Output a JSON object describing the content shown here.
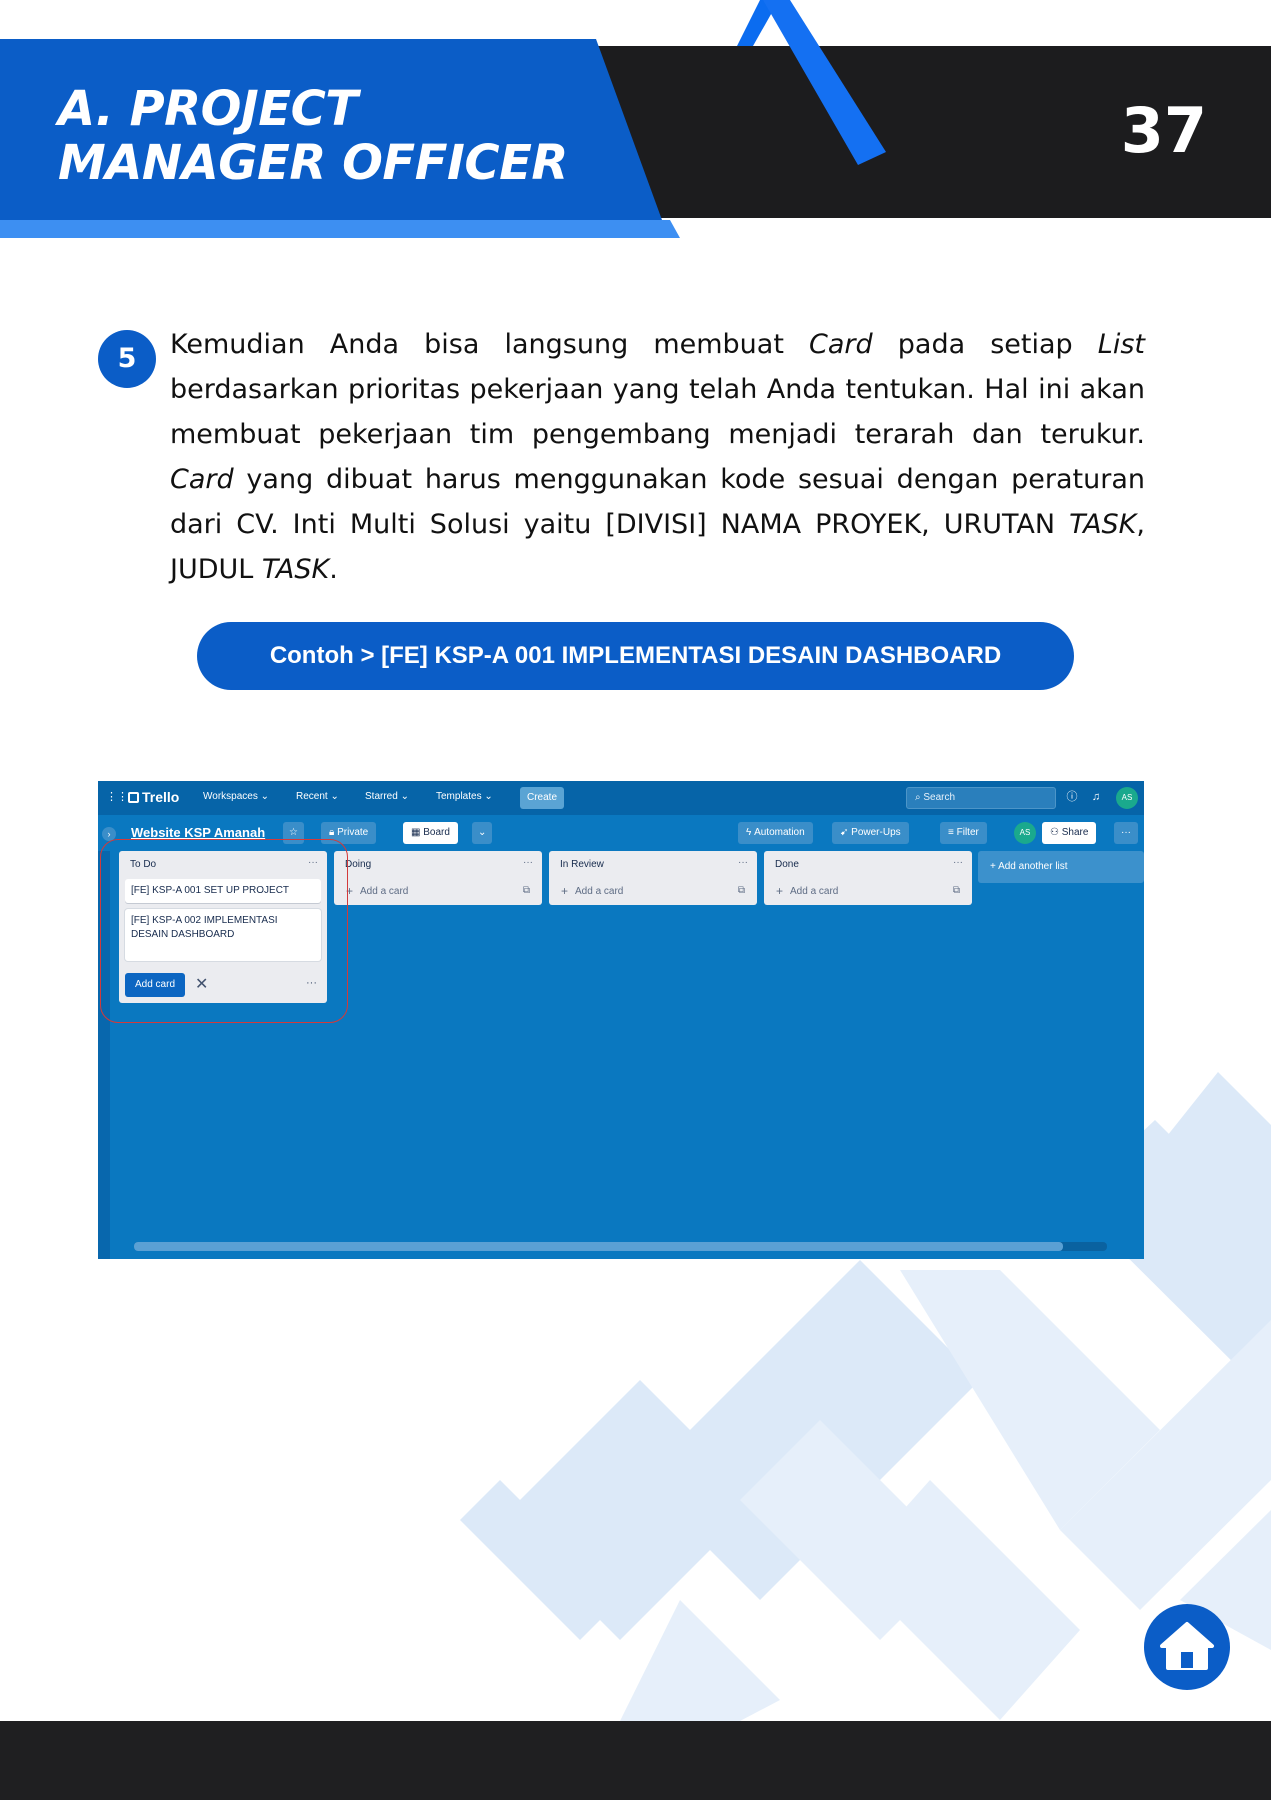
{
  "header": {
    "title_line1": "A. PROJECT",
    "title_line2": "MANAGER OFFICER",
    "page_number": "37"
  },
  "step": {
    "number": "5",
    "text_html": "Kemudian Anda bisa langsung membuat <em>Card</em> pada setiap <em>List</em> berdasarkan prioritas pekerjaan yang telah Anda tentukan. Hal ini akan membuat pekerjaan tim pengembang menjadi terarah dan terukur. <em>Card</em> yang dibuat harus menggunakan kode sesuai dengan peraturan dari CV. Inti Multi Solusi yaitu [DIVISI] NAMA PROYEK, URUTAN <em>TASK</em>, JUDUL <em>TASK</em>."
  },
  "example": {
    "label": "Contoh >  [FE] KSP-A 001 IMPLEMENTASI DESAIN DASHBOARD"
  },
  "trello": {
    "logo": "Trello",
    "menu": [
      "Workspaces ⌄",
      "Recent ⌄",
      "Starred ⌄",
      "Templates ⌄"
    ],
    "create": "Create",
    "search_placeholder": "Search",
    "avatar": "AS",
    "board_title": "Website KSP Amanah",
    "private": "Private",
    "board_view": "Board",
    "automation": "Automation",
    "power_ups": "Power-Ups",
    "filter": "Filter",
    "share": "Share",
    "add_another_list": "+ Add another list",
    "add_card_text": "Add a card",
    "add_card_button": "Add card",
    "lists": [
      {
        "title": "To Do",
        "cards": [
          "[FE] KSP-A 001 SET UP PROJECT",
          "[FE] KSP-A 002 IMPLEMENTASI DESAIN DASHBOARD"
        ]
      },
      {
        "title": "Doing",
        "cards": []
      },
      {
        "title": "In Review",
        "cards": []
      },
      {
        "title": "Done",
        "cards": []
      }
    ]
  },
  "colors": {
    "brand_blue": "#0b5dc7",
    "header_dark": "#1c1c1e",
    "trello_blue": "#0a78c0"
  },
  "icons": [
    "star-icon",
    "lock-icon",
    "board-icon",
    "lightning-icon",
    "rocket-icon",
    "filter-icon",
    "share-icon",
    "info-icon",
    "bell-icon",
    "search-icon",
    "home-icon"
  ]
}
